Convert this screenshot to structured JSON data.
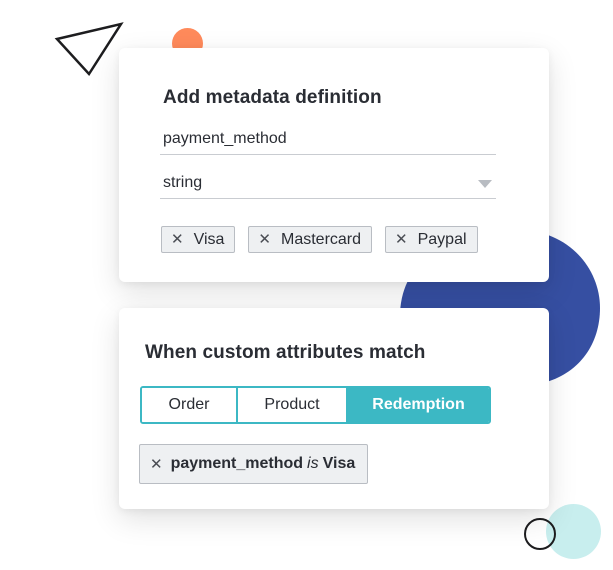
{
  "metadata_card": {
    "title": "Add metadata definition",
    "name_field": {
      "value": "payment_method"
    },
    "type_select": {
      "value": "string"
    },
    "chips": [
      {
        "label": "Visa",
        "remove_icon": "close-icon"
      },
      {
        "label": "Mastercard",
        "remove_icon": "close-icon"
      },
      {
        "label": "Paypal",
        "remove_icon": "close-icon"
      }
    ]
  },
  "rules_card": {
    "title": "When custom attributes match",
    "segments": [
      {
        "label": "Order",
        "active": false
      },
      {
        "label": "Product",
        "active": false
      },
      {
        "label": "Redemption",
        "active": true
      }
    ],
    "condition": {
      "attribute": "payment_method",
      "operator": "is",
      "value": "Visa",
      "remove_icon": "close-icon"
    }
  },
  "colors": {
    "accent_teal": "#3cb8c4",
    "blob_blue": "#364fa2",
    "dot_orange": "#ff8a5b",
    "dot_teal_light": "#c8eeee"
  }
}
